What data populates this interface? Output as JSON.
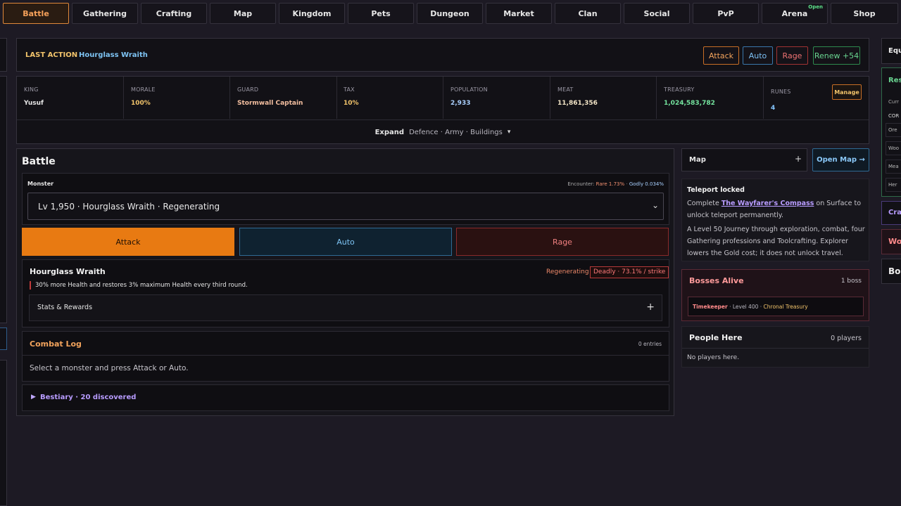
{
  "nav": {
    "tabs": [
      "Battle",
      "Gathering",
      "Crafting",
      "Map",
      "Kingdom",
      "Pets",
      "Dungeon",
      "Market",
      "Clan",
      "Social",
      "PvP",
      "Arena",
      "Shop"
    ],
    "arena_badge": "Open"
  },
  "last_action": {
    "label": "LAST ACTION",
    "target": "Hourglass Wraith",
    "buttons": {
      "attack": "Attack",
      "auto": "Auto",
      "rage": "Rage",
      "renew": "Renew +54"
    }
  },
  "kingdom": {
    "king_label": "KING",
    "king": "Yusuf",
    "morale_label": "MORALE",
    "morale": "100%",
    "guard_label": "GUARD",
    "guard": "Stormwall Captain",
    "tax_label": "TAX",
    "tax": "10%",
    "population_label": "POPULATION",
    "population": "2,933",
    "meat_label": "MEAT",
    "meat": "11,861,356",
    "treasury_label": "TREASURY",
    "treasury": "1,024,583,782",
    "runes_label": "RUNES",
    "runes": "4",
    "manage": "Manage",
    "expand_label": "Expand",
    "expand_items": "Defence · Army · Buildings",
    "expand_caret": "▾"
  },
  "battle": {
    "title": "Battle",
    "monster_label": "Monster",
    "encounter_label": "Encounter:",
    "rare": "Rare 1.73%",
    "godly": "Godly 0.034%",
    "selected_monster": "Lv 1,950 · Hourglass Wraith · Regenerating",
    "attack": "Attack",
    "auto": "Auto",
    "rage": "Rage",
    "monster_name": "Hourglass Wraith",
    "trait": "Regenerating ·",
    "danger": "Deadly · 73.1% / strike",
    "description": "30% more Health and restores 3% maximum Health every third round.",
    "stats_rewards": "Stats & Rewards",
    "combat_log_title": "Combat Log",
    "combat_log_count": "0 entries",
    "combat_log_empty": "Select a monster and press Attack or Auto.",
    "bestiary": "Bestiary · 20 discovered"
  },
  "map": {
    "title": "Map",
    "open_map": "Open Map →",
    "teleport_title": "Teleport locked",
    "teleport_pre": "Complete ",
    "teleport_link": "The Wayfarer's Compass",
    "teleport_post": " on Surface to unlock teleport permanently.",
    "journey_text": "A Level 50 Journey through exploration, combat, four Gathering professions and Toolcrafting. Explorer lowers the Gold cost; it does not unlock travel."
  },
  "bosses": {
    "title": "Bosses Alive",
    "count": "1 boss",
    "boss_name": "Timekeeper",
    "boss_level": "· Level 400 ·",
    "boss_location": "Chronal Treasury"
  },
  "people": {
    "title": "People Here",
    "count": "0 players",
    "empty": "No players here."
  },
  "right_edge": {
    "equip": "Equ",
    "res": "Res",
    "curr": "Curr",
    "cor": "COR",
    "ore": "Ore",
    "woo": "Woo",
    "mea": "Mea",
    "her": "Her",
    "craf": "Craf",
    "wo": "Wo",
    "bo": "Bo"
  },
  "colors": {
    "accent_orange": "#e87a12",
    "auto_blue": "#6ab6ee",
    "rage_red": "#ee6b6b",
    "renew_green": "#5ed68a",
    "gold": "#f2c46b",
    "purple_link": "#b89cff"
  }
}
